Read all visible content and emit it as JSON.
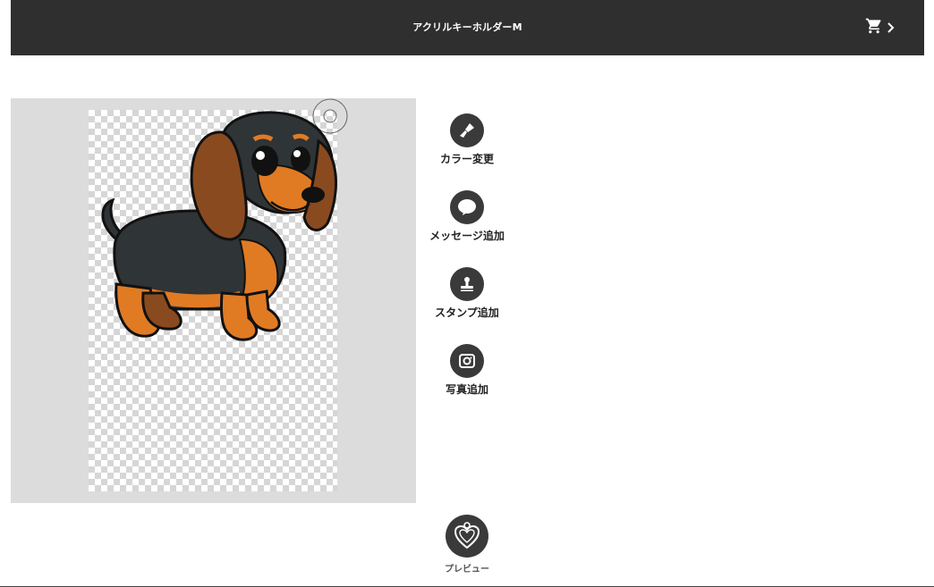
{
  "header": {
    "title": "アクリルキーホルダーM",
    "cart_icon": "cart-icon",
    "chevron_icon": "chevron-right-icon"
  },
  "tools": [
    {
      "label": "カラー変更",
      "icon": "paint-brush-icon"
    },
    {
      "label": "メッセージ追加",
      "icon": "speech-bubble-icon"
    },
    {
      "label": "スタンプ追加",
      "icon": "stamp-icon"
    },
    {
      "label": "写真追加",
      "icon": "camera-icon"
    }
  ],
  "preview": {
    "label": "プレビュー",
    "icon": "heart-keychain-icon"
  },
  "colors": {
    "header_bg": "#2f2f2f",
    "tool_bg": "#3a3a3a",
    "canvas_bg": "#dcdcdc"
  }
}
